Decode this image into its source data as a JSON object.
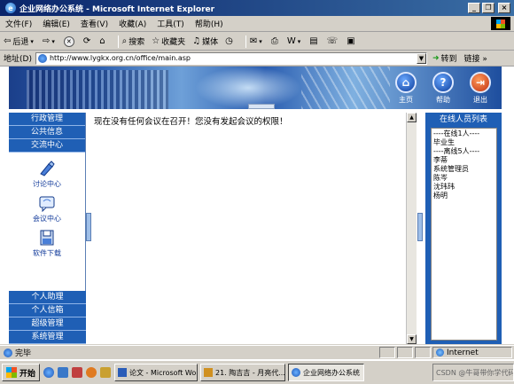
{
  "window": {
    "title": "企业网络办公系统 - Microsoft Internet Explorer",
    "controls": {
      "minimize": "_",
      "maximize": "❐",
      "close": "×"
    }
  },
  "menu": [
    "文件(F)",
    "编辑(E)",
    "查看(V)",
    "收藏(A)",
    "工具(T)",
    "帮助(H)"
  ],
  "toolbar": {
    "back": "后退",
    "search": "搜索",
    "favorites": "收藏夹",
    "media": "媒体"
  },
  "address": {
    "label": "地址(D)",
    "url": "http://www.lygkx.org.cn/office/main.asp",
    "go": "转到",
    "links": "链接"
  },
  "banner": {
    "buttons": [
      {
        "label": "主页",
        "icon": "home-icon"
      },
      {
        "label": "帮助",
        "icon": "help-icon"
      },
      {
        "label": "退出",
        "icon": "exit-icon"
      }
    ]
  },
  "left_sidebar": {
    "top_menu": [
      "行政管理",
      "公共信息",
      "交流中心"
    ],
    "nav_items": [
      {
        "label": "讨论中心",
        "icon": "discussion-icon"
      },
      {
        "label": "会议中心",
        "icon": "meeting-icon"
      },
      {
        "label": "软件下载",
        "icon": "download-icon"
      }
    ],
    "bottom_menu": [
      "个人助理",
      "个人信箱",
      "超级管理",
      "系统管理"
    ]
  },
  "main": {
    "message": "现在没有任何会议在召开！您没有发起会议的权限！"
  },
  "right_sidebar": {
    "title": "在线人员列表",
    "entries": [
      "----在线1人----",
      "毕业生",
      "----离线5人----",
      "李蒂",
      "系统管理员",
      "陈岑",
      "沈玮玮",
      "杨明"
    ]
  },
  "status": {
    "text": "完毕",
    "zone": "Internet"
  },
  "taskbar": {
    "start": "开始",
    "tasks": [
      "论文 - Microsoft Word",
      "21. 陶吉吉 - 月亮代...",
      "企业网络办公系统"
    ],
    "tray_text": "CSDN @牛哥带你学代码"
  }
}
